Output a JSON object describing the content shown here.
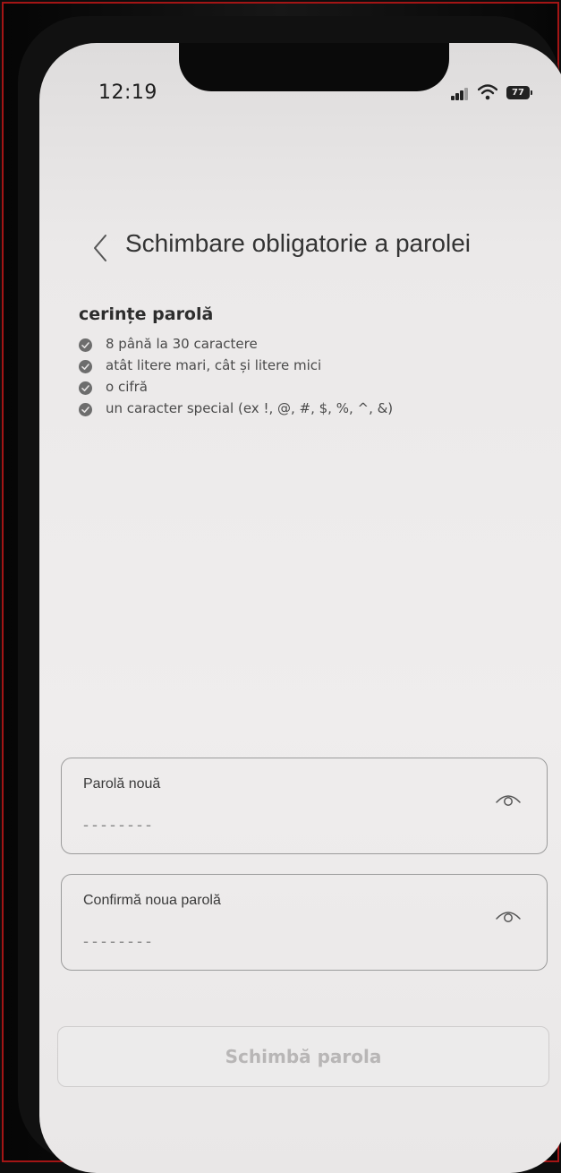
{
  "status_bar": {
    "time": "12:19",
    "battery_level": "77",
    "icons": [
      "signal-icon",
      "wifi-icon",
      "battery-icon"
    ]
  },
  "header": {
    "back_icon": "chevron-left-icon",
    "title": "Schimbare obligatorie a parolei"
  },
  "requirements": {
    "title": "cerințe parolă",
    "items": [
      {
        "label": "8 până la 30 caractere"
      },
      {
        "label": "atât litere mari, cât și litere mici"
      },
      {
        "label": "o cifră"
      },
      {
        "label": "un caracter special (ex !, @, #, $, %, ^, &)"
      }
    ],
    "icon": "check-circle-icon"
  },
  "form": {
    "new_password": {
      "label": "Parolă nouă",
      "placeholder": "--------",
      "icon": "eye-icon"
    },
    "confirm_password": {
      "label": "Confirmă noua parolă",
      "placeholder": "--------",
      "icon": "eye-icon"
    }
  },
  "submit": {
    "label": "Schimbă parola",
    "enabled": false
  },
  "colors": {
    "screen_bg": "#ebe9e9",
    "text": "#343434",
    "check_icon": "#6d6d6d",
    "field_border": "#9b9b9b",
    "button_disabled_text": "#b8b6b6"
  }
}
